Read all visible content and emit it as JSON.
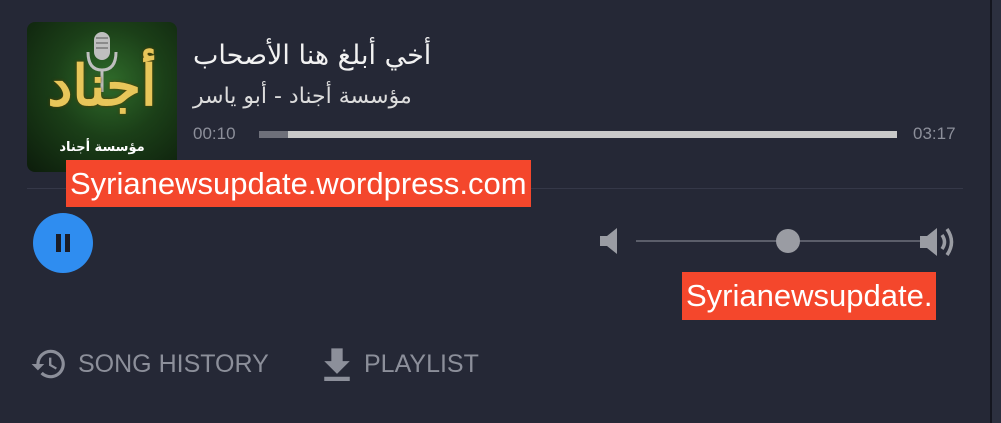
{
  "track": {
    "title": "أخي أبلغ هنا الأصحاب",
    "artist": "مؤسسة أجناد - أبو ياسر",
    "elapsed": "00:10",
    "duration": "03:17",
    "progress_fraction": 0.045
  },
  "album_art": {
    "logo_text": "أجناد",
    "logo_subtitle": "مؤسسة أجناد",
    "mic_icon": "microphone-icon"
  },
  "controls": {
    "play_state": "playing",
    "pause_icon": "pause-icon",
    "volume_low_icon": "volume-low-icon",
    "volume_high_icon": "volume-high-icon",
    "volume_fraction": 0.53
  },
  "watermarks": {
    "top": "Syrianewsupdate.wordpress.com",
    "bottom": "Syrianewsupdate."
  },
  "footer": {
    "history_label": "SONG HISTORY",
    "history_icon": "history-icon",
    "playlist_label": "PLAYLIST",
    "playlist_icon": "download-icon"
  },
  "colors": {
    "panel": "#252836",
    "accent": "#2f8df0",
    "watermark": "#f4472c",
    "muted_text": "#8c8f9a"
  }
}
